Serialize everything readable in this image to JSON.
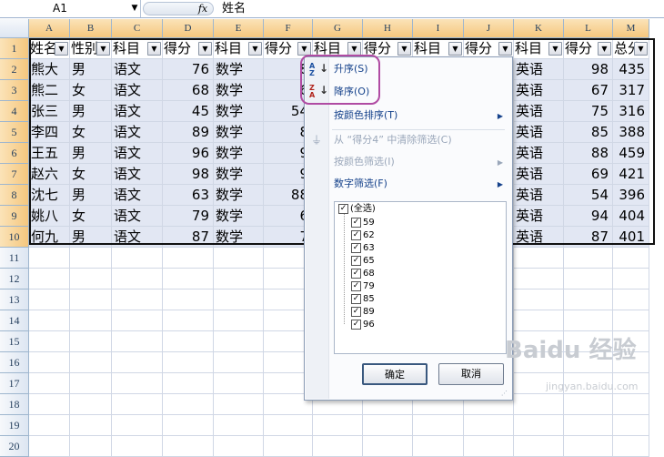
{
  "formula_bar": {
    "name_box": "A1",
    "fx": "fx",
    "content": "姓名"
  },
  "columns": [
    "A",
    "B",
    "C",
    "D",
    "E",
    "F",
    "G",
    "H",
    "I",
    "J",
    "K",
    "L",
    "M"
  ],
  "rows": [
    "1",
    "2",
    "3",
    "4",
    "5",
    "6",
    "7",
    "8",
    "9",
    "10",
    "11",
    "12",
    "13",
    "14",
    "15",
    "16",
    "17",
    "18",
    "19",
    "20"
  ],
  "headers": [
    "姓名",
    "性别",
    "科目",
    "得分",
    "科目",
    "得分",
    "科目",
    "得分",
    "科目",
    "得分",
    "科目",
    "得分",
    "总分"
  ],
  "table": [
    [
      "熊大",
      "男",
      "语文",
      "76",
      "数学",
      "8",
      "",
      "",
      "",
      "",
      "英语",
      "98",
      "435"
    ],
    [
      "熊二",
      "女",
      "语文",
      "68",
      "数学",
      "6",
      "",
      "",
      "",
      "",
      "英语",
      "67",
      "317"
    ],
    [
      "张三",
      "男",
      "语文",
      "45",
      "数学",
      "54",
      "",
      "",
      "",
      "",
      "英语",
      "75",
      "316"
    ],
    [
      "李四",
      "女",
      "语文",
      "89",
      "数学",
      "8",
      "",
      "",
      "",
      "",
      "英语",
      "85",
      "388"
    ],
    [
      "王五",
      "男",
      "语文",
      "96",
      "数学",
      "9",
      "",
      "",
      "",
      "",
      "英语",
      "88",
      "459"
    ],
    [
      "赵六",
      "女",
      "语文",
      "98",
      "数学",
      "9",
      "",
      "",
      "",
      "",
      "英语",
      "69",
      "421"
    ],
    [
      "沈七",
      "男",
      "语文",
      "63",
      "数学",
      "88",
      "",
      "",
      "",
      "",
      "英语",
      "54",
      "396"
    ],
    [
      "姚八",
      "女",
      "语文",
      "79",
      "数学",
      "6",
      "",
      "",
      "",
      "",
      "英语",
      "94",
      "404"
    ],
    [
      "何九",
      "男",
      "语文",
      "87",
      "数学",
      "7",
      "",
      "",
      "",
      "",
      "英语",
      "87",
      "401"
    ]
  ],
  "menu": {
    "sort_asc": "升序(S)",
    "sort_desc": "降序(O)",
    "sort_by_color": "按颜色排序(T)",
    "clear_filter": "从 “得分4” 中清除筛选(C)",
    "filter_by_color": "按颜色筛选(I)",
    "number_filter": "数字筛选(F)",
    "select_all": "(全选)",
    "values": [
      "59",
      "62",
      "63",
      "65",
      "68",
      "79",
      "85",
      "89",
      "96"
    ],
    "ok": "确定",
    "cancel": "取消"
  },
  "watermark": {
    "main": "Baidu 经验",
    "sub": "jingyan.baidu.com"
  },
  "colors": {
    "highlight": "#b04ba3",
    "range_fill": "#e2e7f3",
    "menu_text": "#15428b"
  }
}
